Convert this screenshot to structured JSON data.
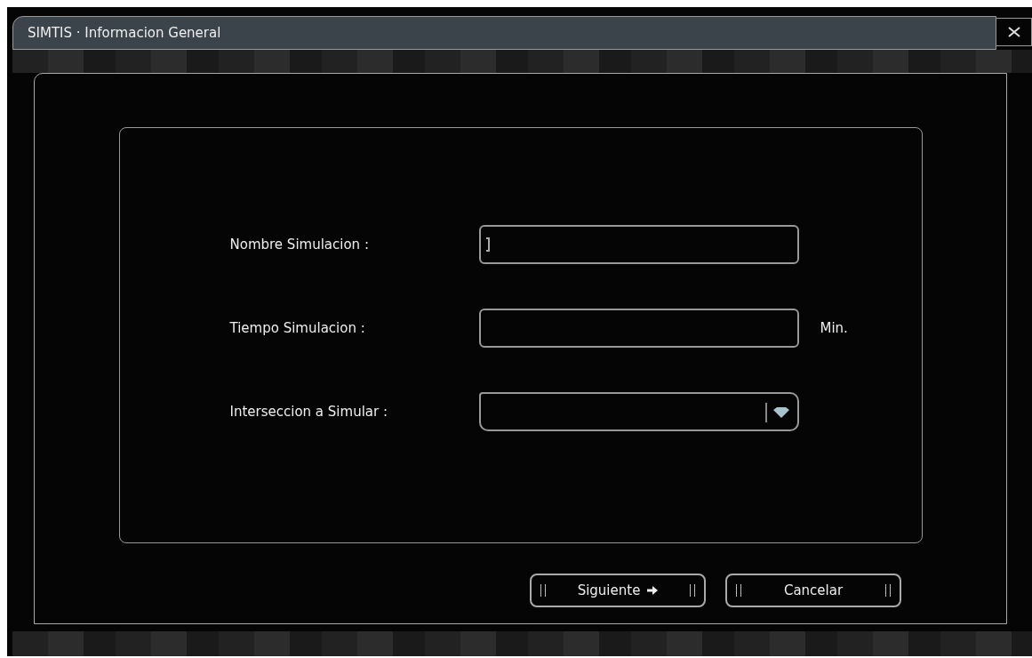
{
  "window": {
    "title": "SIMTIS · Informacion General"
  },
  "form": {
    "fields": [
      {
        "kind": "text",
        "label": "Nombre Simulacion :",
        "focused": true
      },
      {
        "kind": "text",
        "label": "Tiempo Simulacion :",
        "focused": false,
        "unit": "Min."
      },
      {
        "kind": "dropdown",
        "label": "Interseccion a Simular :",
        "focused": false
      }
    ]
  },
  "buttons": [
    {
      "label": "Siguiente",
      "kind": "next"
    },
    {
      "label": "Cancelar",
      "kind": "cancel"
    }
  ]
}
